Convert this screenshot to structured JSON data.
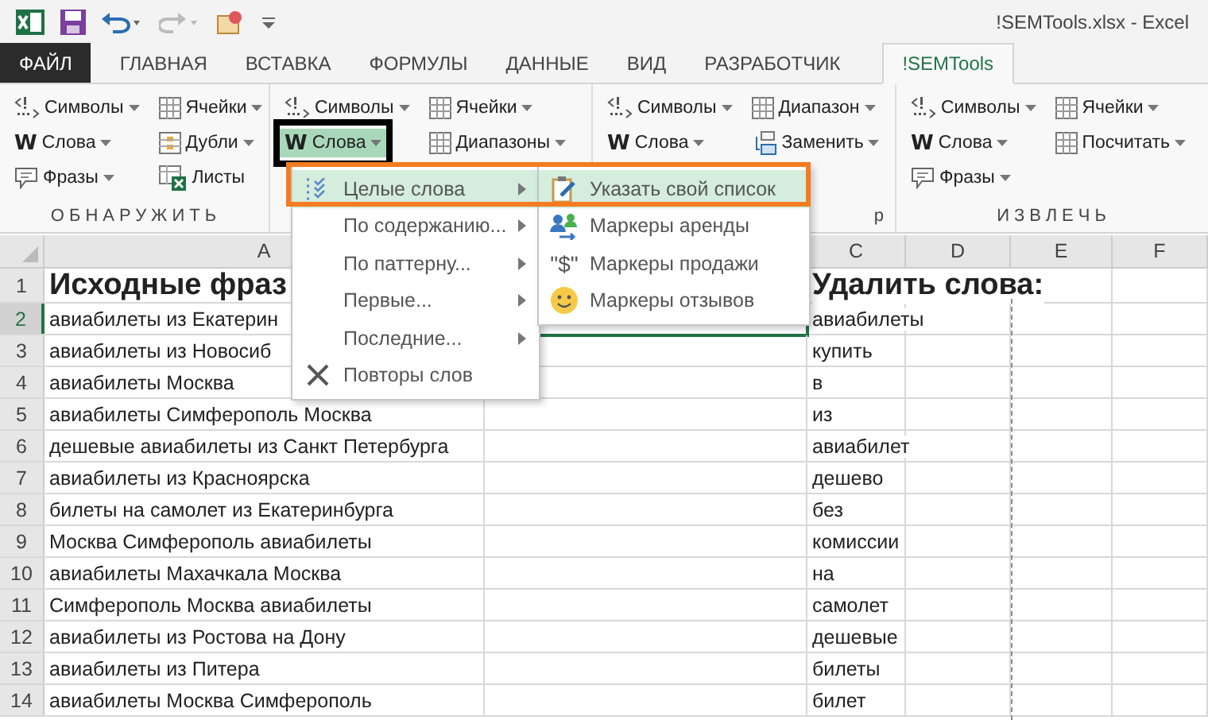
{
  "window": {
    "title": "!SEMTools.xlsx - Excel"
  },
  "tabs": [
    {
      "label": "ФАЙЛ",
      "kind": "file",
      "selected": false
    },
    {
      "label": "ГЛАВНАЯ",
      "kind": "tab",
      "selected": false
    },
    {
      "label": "ВСТАВКА",
      "kind": "tab",
      "selected": false
    },
    {
      "label": "ФОРМУЛЫ",
      "kind": "tab",
      "selected": false
    },
    {
      "label": "ДАННЫЕ",
      "kind": "tab",
      "selected": false
    },
    {
      "label": "ВИД",
      "kind": "tab",
      "selected": false
    },
    {
      "label": "РАЗРАБОТЧИК",
      "kind": "tab",
      "selected": false
    },
    {
      "label": "!SEMTools",
      "kind": "tab",
      "selected": true
    }
  ],
  "ribbon": {
    "groups": [
      {
        "label": "ОБНАРУЖИТЬ",
        "columns": [
          [
            {
              "label": "Символы",
              "kind": "symbols",
              "dropdown": true,
              "selected": false,
              "framed": false
            },
            {
              "label": "Слова",
              "kind": "word",
              "glyph": "W",
              "dropdown": true,
              "selected": false,
              "framed": false
            },
            {
              "label": "Фразы",
              "kind": "bubble",
              "dropdown": true,
              "selected": false,
              "framed": false
            }
          ],
          [
            {
              "label": "Ячейки",
              "kind": "grid",
              "dropdown": true,
              "selected": false,
              "framed": false
            },
            {
              "label": "Дубли",
              "kind": "dupes",
              "dropdown": true,
              "selected": false,
              "framed": false
            },
            {
              "label": "Листы",
              "kind": "sheets",
              "dropdown": false,
              "selected": false,
              "framed": false
            }
          ]
        ]
      },
      {
        "columns": [
          [
            {
              "label": "Символы",
              "kind": "symbols",
              "dropdown": true,
              "selected": false,
              "framed": false
            },
            {
              "label": "Слова",
              "kind": "word",
              "glyph": "W",
              "dropdown": true,
              "selected": true,
              "framed": true
            }
          ],
          [
            {
              "label": "Ячейки",
              "kind": "grid",
              "dropdown": true,
              "selected": false,
              "framed": false
            },
            {
              "label": "Диапазоны",
              "kind": "grid",
              "dropdown": true,
              "selected": false,
              "framed": false
            }
          ]
        ]
      },
      {
        "label": "р",
        "columns": [
          [
            {
              "label": "Символы",
              "kind": "symbols",
              "dropdown": true,
              "selected": false,
              "framed": false
            },
            {
              "label": "Слова",
              "kind": "word",
              "glyph": "W",
              "dropdown": true,
              "selected": false,
              "framed": false
            }
          ],
          [
            {
              "label": "Диапазон",
              "kind": "grid",
              "dropdown": true,
              "selected": false,
              "framed": false
            },
            {
              "label": "Заменить",
              "kind": "replace",
              "dropdown": true,
              "selected": false,
              "framed": false
            }
          ]
        ]
      },
      {
        "label": "ИЗВЛЕЧЬ",
        "columns": [
          [
            {
              "label": "Символы",
              "kind": "symbols",
              "dropdown": true,
              "selected": false,
              "framed": false
            },
            {
              "label": "Слова",
              "kind": "word",
              "glyph": "W",
              "dropdown": true,
              "selected": false,
              "framed": false
            },
            {
              "label": "Фразы",
              "kind": "bubble",
              "dropdown": true,
              "selected": false,
              "framed": false
            }
          ],
          [
            {
              "label": "Ячейки",
              "kind": "grid",
              "dropdown": true,
              "selected": false,
              "framed": false
            },
            {
              "label": "Посчитать",
              "kind": "grid",
              "dropdown": true,
              "selected": false,
              "framed": false
            }
          ]
        ]
      }
    ]
  },
  "menu": {
    "framed": true,
    "items": [
      {
        "label": "Целые слова",
        "kind": "checklist",
        "submenu": true,
        "selected": true
      },
      {
        "label": "По содержанию...",
        "kind": "plain",
        "submenu": true,
        "selected": false
      },
      {
        "label": "По паттерну...",
        "kind": "plain",
        "submenu": true,
        "selected": false
      },
      {
        "label": "Первые...",
        "kind": "plain",
        "submenu": true,
        "selected": false
      },
      {
        "label": "Последние...",
        "kind": "plain",
        "submenu": true,
        "selected": false
      },
      {
        "label": "Повторы слов",
        "kind": "cross",
        "submenu": false,
        "selected": false
      }
    ],
    "submenu": [
      {
        "label": "Указать свой список",
        "kind": "clipboard",
        "selected": true
      },
      {
        "label": "Маркеры аренды",
        "kind": "people",
        "selected": false
      },
      {
        "label": "Маркеры продажи",
        "kind": "glyph",
        "glyph": "\"$\"",
        "selected": false
      },
      {
        "label": "Маркеры отзывов",
        "kind": "smiley",
        "selected": false
      }
    ]
  },
  "sheet": {
    "columns": [
      "A",
      null,
      "C",
      "D",
      "E",
      "F"
    ],
    "rows": [
      {
        "number": "1",
        "kind": "header",
        "selected": false,
        "a": "Исходные фраз",
        "c": "Удалить слова:"
      },
      {
        "number": "2",
        "kind": "data",
        "selected": true,
        "a": "авиабилеты из Екатерин",
        "c": "авиабилеты"
      },
      {
        "number": "3",
        "kind": "data",
        "selected": false,
        "a": "авиабилеты из Новосиб",
        "c": "купить"
      },
      {
        "number": "4",
        "kind": "data",
        "selected": false,
        "a": "авиабилеты Москва",
        "c": "в"
      },
      {
        "number": "5",
        "kind": "data",
        "selected": false,
        "a": "авиабилеты Симферополь Москва",
        "c": "из"
      },
      {
        "number": "6",
        "kind": "data",
        "selected": false,
        "a": "дешевые авиабилеты из Санкт Петербурга",
        "c": "авиабилет"
      },
      {
        "number": "7",
        "kind": "data",
        "selected": false,
        "a": "авиабилеты из Красноярска",
        "c": "дешево"
      },
      {
        "number": "8",
        "kind": "data",
        "selected": false,
        "a": "билеты на самолет из Екатеринбурга",
        "c": "без"
      },
      {
        "number": "9",
        "kind": "data",
        "selected": false,
        "a": "Москва Симферополь авиабилеты",
        "c": "комиссии"
      },
      {
        "number": "10",
        "kind": "data",
        "selected": false,
        "a": "авиабилеты Махачкала Москва",
        "c": "на"
      },
      {
        "number": "11",
        "kind": "data",
        "selected": false,
        "a": "Симферополь Москва авиабилеты",
        "c": "самолет"
      },
      {
        "number": "12",
        "kind": "data",
        "selected": false,
        "a": "авиабилеты из Ростова на Дону",
        "c": "дешевые"
      },
      {
        "number": "13",
        "kind": "data",
        "selected": false,
        "a": "авиабилеты из Питера",
        "c": "билеты"
      },
      {
        "number": "14",
        "kind": "data",
        "selected": false,
        "a": "авиабилеты Москва Симферополь",
        "c": "билет"
      }
    ]
  }
}
